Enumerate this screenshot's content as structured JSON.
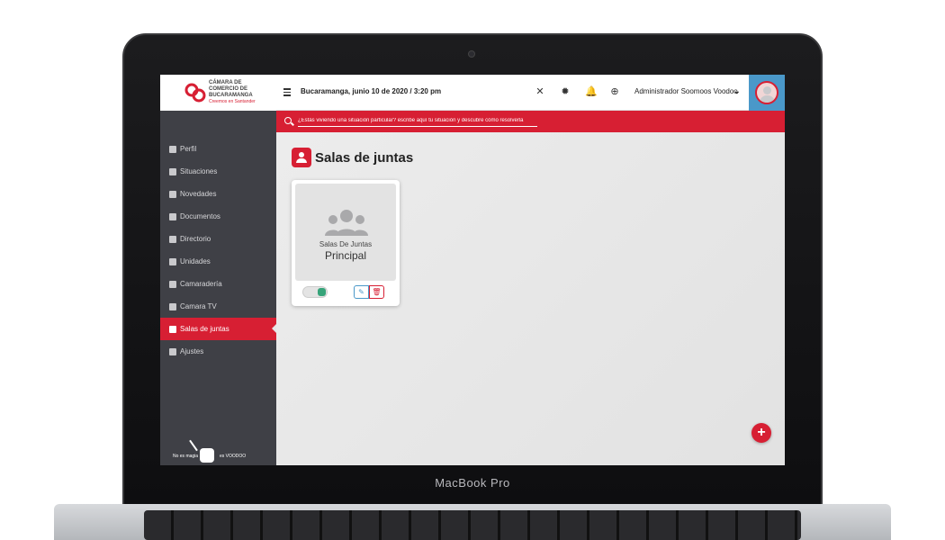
{
  "device": {
    "label": "MacBook Pro"
  },
  "logo": {
    "line1": "CÁMARA DE",
    "line2": "COMERCIO DE",
    "line3": "BUCARAMANGA",
    "tagline": "Creemos en Santander"
  },
  "topbar": {
    "datetime": "Bucaramanga, junio 10 de 2020 / 3:20 pm",
    "user_name": "Administrador Soomoos Voodoo"
  },
  "search": {
    "placeholder": "¿Estás viviendo una situación particular? escribe aquí tu situación y descubre cómo resolverla"
  },
  "sidebar": {
    "items": [
      {
        "label": "Perfil",
        "icon": "id-card-icon"
      },
      {
        "label": "Situaciones",
        "icon": "hand-icon"
      },
      {
        "label": "Novedades",
        "icon": "calendar-icon"
      },
      {
        "label": "Documentos",
        "icon": "document-icon"
      },
      {
        "label": "Directorio",
        "icon": "phone-icon"
      },
      {
        "label": "Unidades",
        "icon": "grid-icon"
      },
      {
        "label": "Camaradería",
        "icon": "thumbs-up-icon"
      },
      {
        "label": "Camara TV",
        "icon": "video-icon"
      },
      {
        "label": "Salas de juntas",
        "icon": "users-icon"
      },
      {
        "label": "Ajustes",
        "icon": "gear-icon"
      }
    ],
    "active_index": 8,
    "footer_left": "No es magia",
    "footer_right": "es VOODOO"
  },
  "page": {
    "title": "Salas de juntas"
  },
  "cards": [
    {
      "subtitle": "Salas De Juntas",
      "name": "Principal",
      "enabled": true
    }
  ],
  "colors": {
    "accent": "#d71f33",
    "sidebar": "#3f4046",
    "avatar_bg": "#4a98c9",
    "toggle_on": "#37a47a"
  }
}
